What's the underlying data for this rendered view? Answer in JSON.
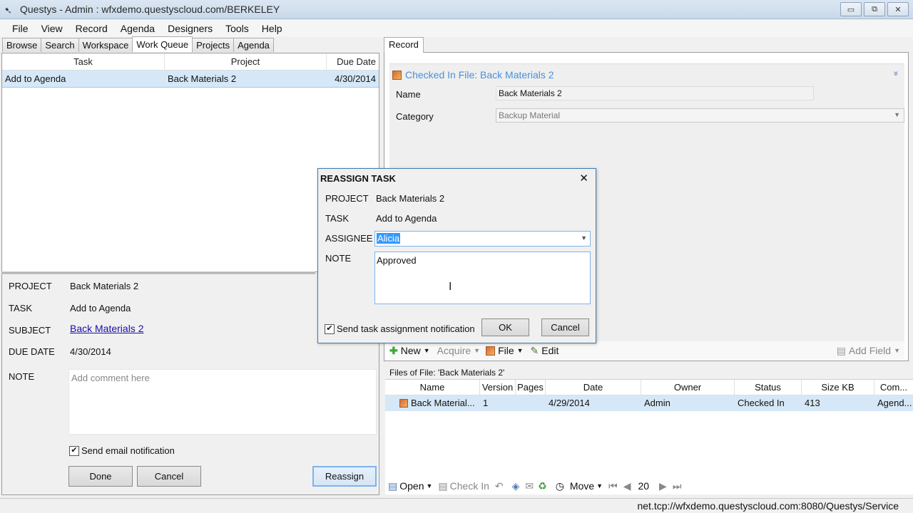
{
  "window": {
    "title": "Questys - Admin : wfxdemo.questyscloud.com/BERKELEY",
    "controls": {
      "minimize": "▭",
      "restore": "⧉",
      "close": "✕"
    }
  },
  "menu": [
    "File",
    "View",
    "Record",
    "Agenda",
    "Designers",
    "Tools",
    "Help"
  ],
  "left_tabs": [
    {
      "label": "Browse",
      "active": false
    },
    {
      "label": "Search",
      "active": false
    },
    {
      "label": "Workspace",
      "active": false
    },
    {
      "label": "Work Queue",
      "active": true
    },
    {
      "label": "Projects",
      "active": false
    },
    {
      "label": "Agenda",
      "active": false
    }
  ],
  "work_queue": {
    "columns": [
      "Task",
      "Project",
      "Due Date"
    ],
    "rows": [
      {
        "task": "Add to Agenda",
        "project": "Back Materials 2",
        "due": "4/30/2014"
      }
    ]
  },
  "task_detail": {
    "project_label": "PROJECT",
    "project": "Back Materials 2",
    "task_label": "TASK",
    "task": "Add to Agenda",
    "subject_label": "SUBJECT",
    "subject": "Back Materials 2",
    "due_label": "DUE DATE",
    "due": "4/30/2014",
    "note_label": "NOTE",
    "note_placeholder": "Add comment here",
    "email_notification": "Send email notification",
    "email_checked": true,
    "done": "Done",
    "cancel": "Cancel",
    "reassign": "Reassign"
  },
  "record": {
    "tab": "Record",
    "heading": "Checked In File: Back Materials 2",
    "collapse_icon": "»",
    "name_label": "Name",
    "name": "Back Materials 2",
    "category_label": "Category",
    "category": "Backup Material",
    "toolbar": {
      "new": "New",
      "acquire": "Acquire",
      "file": "File",
      "edit": "Edit",
      "add_field": "Add Field"
    }
  },
  "files": {
    "label": "Files of File: 'Back Materials 2'",
    "columns": [
      "Name",
      "Version",
      "Pages",
      "Date",
      "Owner",
      "Status",
      "Size KB",
      "Com..."
    ],
    "rows": [
      {
        "name": "Back Material...",
        "version": "1",
        "pages": "",
        "date": "4/29/2014",
        "owner": "Admin",
        "status": "Checked In",
        "size": "413",
        "comment": "Agend..."
      }
    ]
  },
  "bottom_toolbar": {
    "open": "Open",
    "check_in": "Check In",
    "move": "Move",
    "page": "20"
  },
  "status": "net.tcp://wfxdemo.questyscloud.com:8080/Questys/Service",
  "dialog": {
    "title": "REASSIGN TASK",
    "close": "✕",
    "project_label": "PROJECT",
    "project": "Back Materials 2",
    "task_label": "TASK",
    "task": "Add to Agenda",
    "assignee_label": "ASSIGNEE",
    "assignee": "Alicia",
    "note_label": "NOTE",
    "note": "Approved",
    "notify": "Send task assignment notification",
    "notify_checked": true,
    "ok": "OK",
    "cancel": "Cancel"
  }
}
